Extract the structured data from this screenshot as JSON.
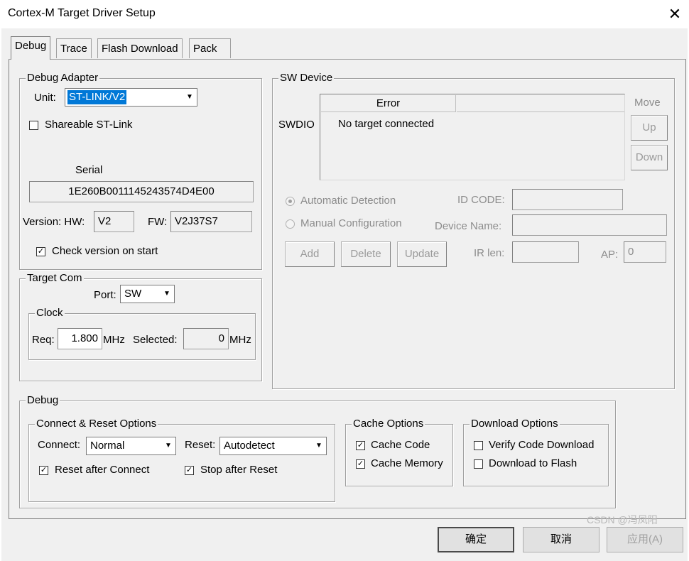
{
  "window": {
    "title": "Cortex-M Target Driver Setup"
  },
  "tabs": [
    "Debug",
    "Trace",
    "Flash Download",
    "Pack"
  ],
  "debug_adapter": {
    "title": "Debug Adapter",
    "unit_label": "Unit:",
    "unit_value": "ST-LINK/V2",
    "shareable_label": "Shareable ST-Link",
    "shareable_checked": false,
    "serial_label": "Serial",
    "serial_value": "1E260B0011145243574D4E00",
    "version_hw_label": "Version: HW:",
    "hw_value": "V2",
    "fw_label": "FW:",
    "fw_value": "V2J37S7",
    "check_version_label": "Check version on start",
    "check_version_checked": true
  },
  "target_com": {
    "title": "Target Com",
    "port_label": "Port:",
    "port_value": "SW",
    "clock_title": "Clock",
    "req_label": "Req:",
    "req_value": "1.800",
    "mhz_unit": "MHz",
    "selected_label": "Selected:",
    "selected_value": "0"
  },
  "sw_device": {
    "title": "SW Device",
    "swdio_label": "SWDIO",
    "error_header": "Error",
    "row_text": "No target connected",
    "move_label": "Move",
    "up_label": "Up",
    "down_label": "Down",
    "auto_detect_label": "Automatic Detection",
    "auto_detect_selected": true,
    "manual_config_label": "Manual Configuration",
    "id_code_label": "ID CODE:",
    "device_name_label": "Device Name:",
    "add_label": "Add",
    "delete_label": "Delete",
    "update_label": "Update",
    "ir_len_label": "IR len:",
    "ap_label": "AP:",
    "ap_value": "0"
  },
  "debug_section": {
    "title": "Debug",
    "connect_reset_title": "Connect & Reset Options",
    "connect_label": "Connect:",
    "connect_value": "Normal",
    "reset_label": "Reset:",
    "reset_value": "Autodetect",
    "reset_after_connect_label": "Reset after Connect",
    "reset_after_connect_checked": true,
    "stop_after_reset_label": "Stop after Reset",
    "stop_after_reset_checked": true,
    "cache_options_title": "Cache Options",
    "cache_code_label": "Cache Code",
    "cache_code_checked": true,
    "cache_memory_label": "Cache Memory",
    "cache_memory_checked": true,
    "download_options_title": "Download Options",
    "verify_code_label": "Verify Code Download",
    "verify_code_checked": false,
    "download_flash_label": "Download to Flash",
    "download_flash_checked": false
  },
  "dialog_buttons": {
    "ok": "确定",
    "cancel": "取消",
    "apply": "应用(A)"
  },
  "watermark": "CSDN @冯凤阳",
  "glyphs": {
    "close": "✕",
    "check": "✓",
    "dropdown": "▼"
  }
}
